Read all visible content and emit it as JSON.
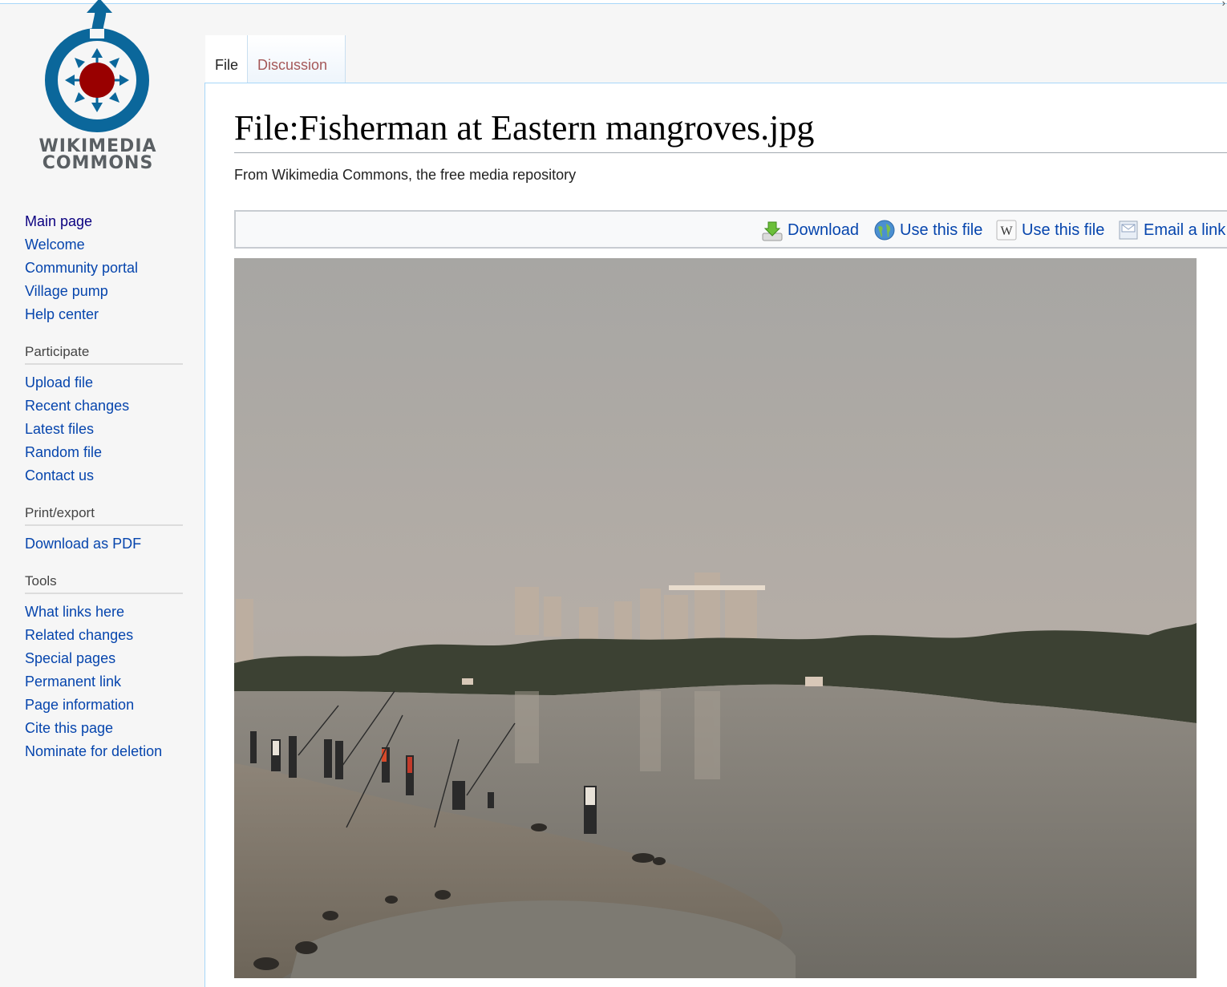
{
  "logo": {
    "line1": "WIKIMEDIA",
    "line2": "COMMONS"
  },
  "sidebar": {
    "navigation": [
      "Main page",
      "Welcome",
      "Community portal",
      "Village pump",
      "Help center"
    ],
    "participate": {
      "heading": "Participate",
      "items": [
        "Upload file",
        "Recent changes",
        "Latest files",
        "Random file",
        "Contact us"
      ]
    },
    "print": {
      "heading": "Print/export",
      "items": [
        "Download as PDF"
      ]
    },
    "tools": {
      "heading": "Tools",
      "items": [
        "What links here",
        "Related changes",
        "Special pages",
        "Permanent link",
        "Page information",
        "Cite this page",
        "Nominate for deletion"
      ]
    }
  },
  "tabs": {
    "file": "File",
    "discussion": "Discussion"
  },
  "page": {
    "title": "File:Fisherman at Eastern mangroves.jpg",
    "tagline": "From Wikimedia Commons, the free media repository"
  },
  "toolbar": {
    "download": "Download",
    "use_web": "Use this file",
    "use_wiki": "Use this file",
    "email": "Email a link"
  },
  "colors": {
    "link": "#0645ad",
    "visited": "#0b0080",
    "discussion_tab": "#a55858",
    "logo_blue": "#0b679b",
    "logo_red": "#990000"
  }
}
